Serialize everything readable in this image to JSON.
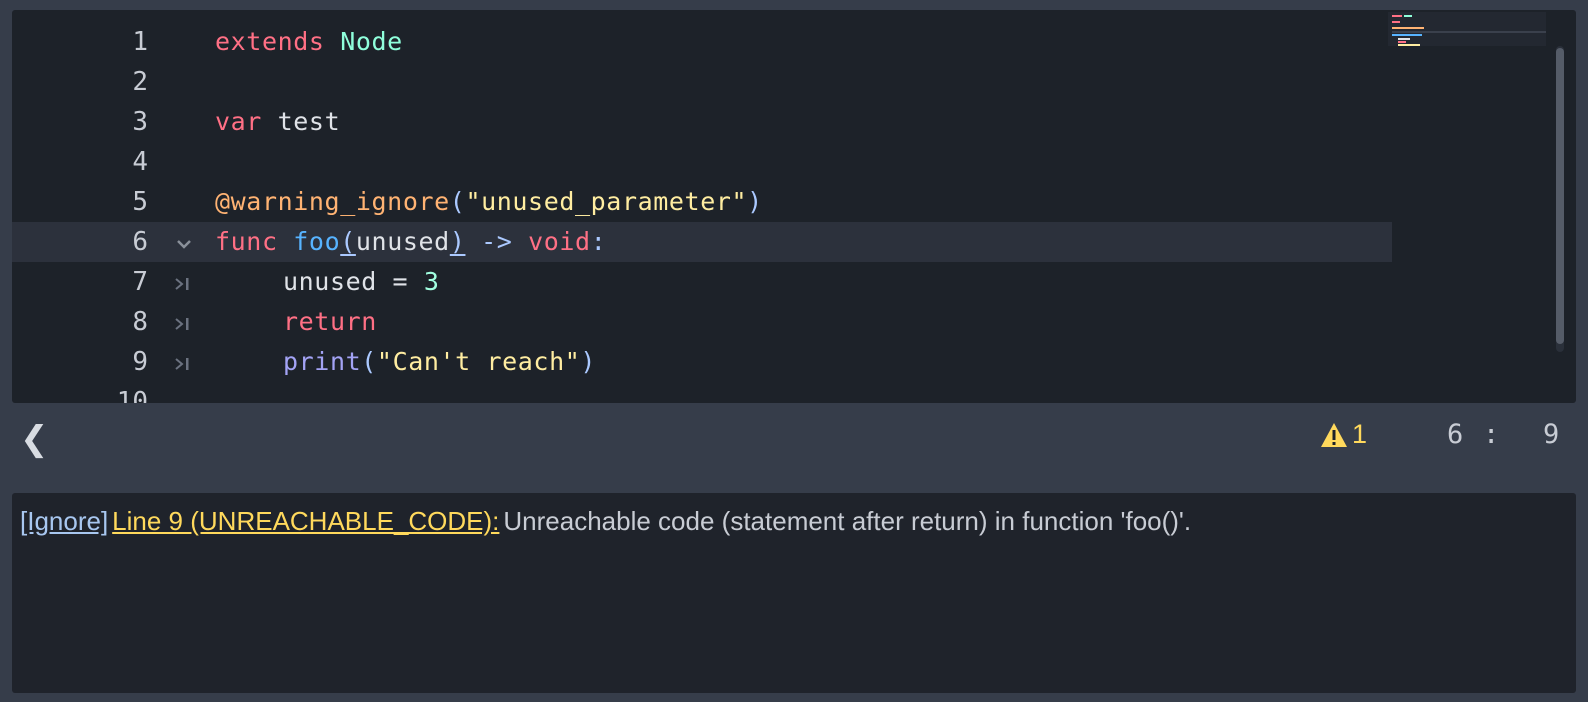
{
  "editor": {
    "lines": [
      {
        "num": "1",
        "tokens": [
          {
            "t": "extends",
            "c": "kw"
          },
          {
            "t": " ",
            "c": ""
          },
          {
            "t": "Node",
            "c": "type"
          }
        ]
      },
      {
        "num": "2",
        "tokens": []
      },
      {
        "num": "3",
        "tokens": [
          {
            "t": "var",
            "c": "kw"
          },
          {
            "t": " test",
            "c": ""
          }
        ]
      },
      {
        "num": "4",
        "tokens": []
      },
      {
        "num": "5",
        "tokens": [
          {
            "t": "@warning_ignore",
            "c": "anno"
          },
          {
            "t": "(",
            "c": "punc"
          },
          {
            "t": "\"unused_parameter\"",
            "c": "str"
          },
          {
            "t": ")",
            "c": "punc"
          }
        ]
      },
      {
        "num": "6",
        "current": true,
        "fold": true,
        "tokens": [
          {
            "t": "func",
            "c": "kw"
          },
          {
            "t": " ",
            "c": ""
          },
          {
            "t": "foo",
            "c": "fn"
          },
          {
            "t": "(",
            "c": "punc brace-hl"
          },
          {
            "t": "unused",
            "c": ""
          },
          {
            "t": ")",
            "c": "punc brace-hl"
          },
          {
            "t": " -> ",
            "c": "punc"
          },
          {
            "t": "void",
            "c": "kw"
          },
          {
            "t": ":",
            "c": "punc"
          }
        ]
      },
      {
        "num": "7",
        "indent": true,
        "tokens": [
          {
            "t": "unused = ",
            "c": ""
          },
          {
            "t": "3",
            "c": "num"
          }
        ]
      },
      {
        "num": "8",
        "indent": true,
        "tokens": [
          {
            "t": "return",
            "c": "kw"
          }
        ]
      },
      {
        "num": "9",
        "indent": true,
        "tokens": [
          {
            "t": "print",
            "c": "builtin"
          },
          {
            "t": "(",
            "c": "punc"
          },
          {
            "t": "\"Can't reach\"",
            "c": "str"
          },
          {
            "t": ")",
            "c": "punc"
          }
        ]
      },
      {
        "num": "10",
        "tokens": []
      }
    ]
  },
  "icons": {
    "fold": "chevron-down-icon",
    "tab": "tab-indent-icon",
    "back": "chevron-left-icon",
    "warning": "warning-triangle-icon"
  },
  "status": {
    "back_label": "❮",
    "warning_count": "1",
    "line": "6",
    "separator": ":",
    "column": "9"
  },
  "output": {
    "ignore_label": "[Ignore]",
    "warning_label": "Line 9 (UNREACHABLE_CODE):",
    "message": "Unreachable code (statement after return) in function 'foo()'."
  },
  "colors": {
    "keyword": "#ff7085",
    "type": "#8fffdb",
    "annotation": "#ffb373",
    "string": "#ffeda1",
    "warning": "#ffd95c",
    "link": "#a8c7f0"
  }
}
